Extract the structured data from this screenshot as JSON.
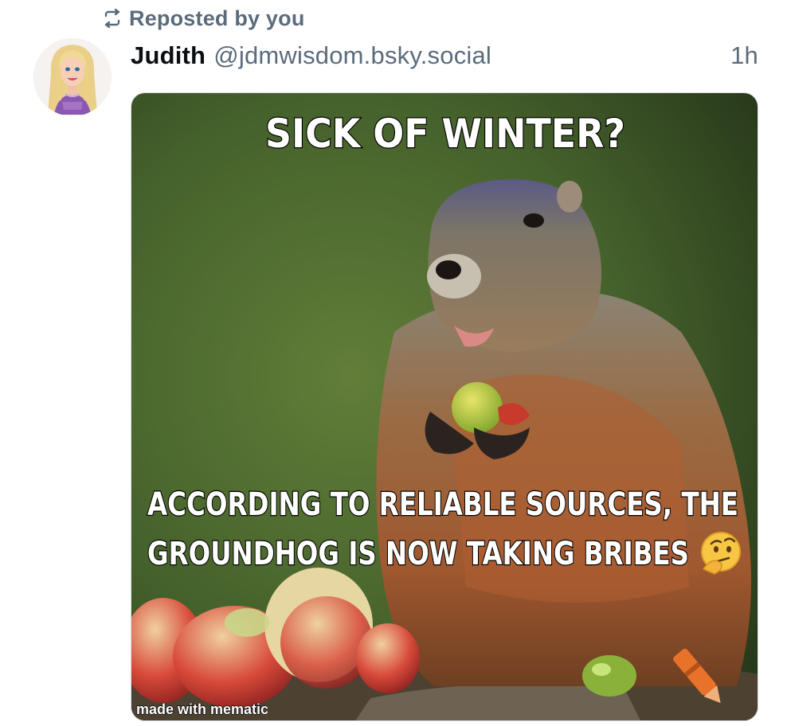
{
  "repost": {
    "icon": "repost-icon",
    "label": "Reposted by you"
  },
  "post": {
    "author_name": "Judith",
    "author_handle": "@jdmwisdom.bsky.social",
    "time": "1h",
    "avatar": "avatar-doll-image"
  },
  "image": {
    "top_text": "SICK OF WINTER?",
    "bottom_line_1": "ACCORDING TO RELIABLE SOURCES, THE",
    "bottom_line_2": "GROUNDHOG IS NOW TAKING BRIBES",
    "watermark": "made with mematic",
    "emoji_icon": "thinking-face-icon",
    "colors": {
      "repost_gray": "#5b6b7b",
      "background_green": "#4f6a33",
      "groundhog_fur": "#a26a3e"
    }
  }
}
